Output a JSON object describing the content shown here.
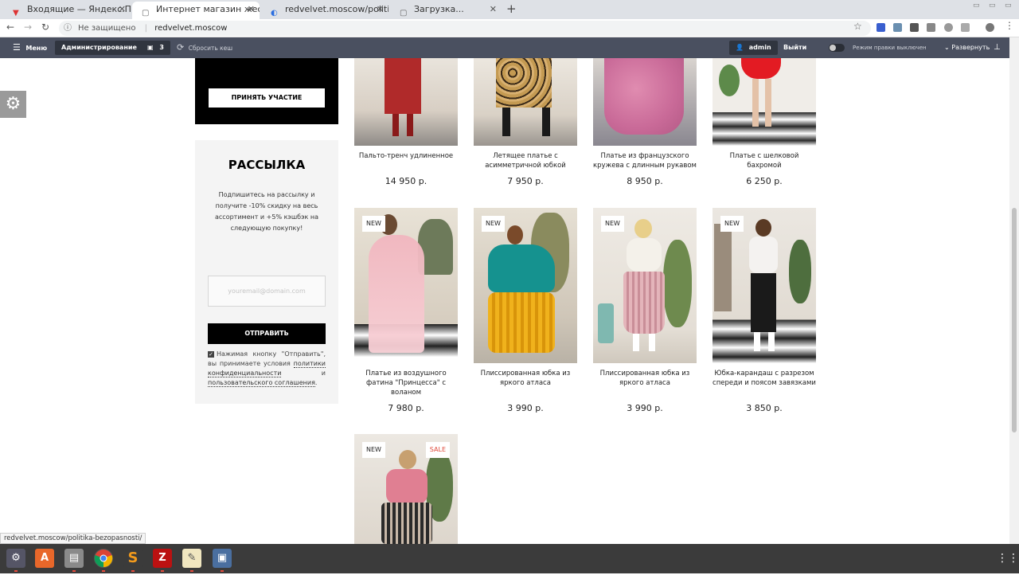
{
  "browser": {
    "tabs": [
      {
        "title": "Входящие — Яндекс.По",
        "icon": "yandex-mail-icon",
        "active": false
      },
      {
        "title": "Интернет магазин жеско",
        "icon": "page-icon",
        "active": true
      },
      {
        "title": "redvelvet.moscow/politi",
        "icon": "loading-icon",
        "active": false
      },
      {
        "title": "Загрузка...",
        "icon": "page-icon",
        "active": false
      }
    ],
    "not_secure": "Не защищено",
    "url": "redvelvet.moscow"
  },
  "adminbar": {
    "menu": "Меню",
    "administration": "Администрирование",
    "comments_count": "3",
    "reset_cache": "Сбросить кеш",
    "user": "admin",
    "logout": "Выйти",
    "edit_mode_label": "Режим правки",
    "edit_mode_state": "выключен",
    "expand": "Развернуть"
  },
  "promo": {
    "button": "ПРИНЯТЬ УЧАСТИЕ"
  },
  "newsletter": {
    "title": "РАССЫЛКА",
    "text": "Подпишитесь на рассылку и получите -10% скидку на весь ассортимент и +5% кэшбэк на следующую покупку!",
    "placeholder": "youremail@domain.com",
    "submit": "ОТПРАВИТЬ",
    "consent_prefix": "Нажимая кнопку \"Отправить\", вы принимаете условия",
    "consent_link1": "политики конфиденциальности",
    "consent_and": "и",
    "consent_link2": "пользовательского соглашения",
    "consent_suffix": "."
  },
  "products": [
    {
      "name": "Пальто-тренч удлиненное",
      "price": "14 950 р.",
      "badges": []
    },
    {
      "name": "Летящее платье с асимметричной юбкой",
      "price": "7 950 р.",
      "badges": []
    },
    {
      "name": "Платье из французского кружева с длинным рукавом",
      "price": "8 950 р.",
      "badges": []
    },
    {
      "name": "Платье с шелковой бахромой",
      "price": "6 250 р.",
      "badges": []
    },
    {
      "name": "Платье из воздушного фатина \"Принцесса\" с воланом",
      "price": "7 980 р.",
      "badges": [
        "NEW"
      ]
    },
    {
      "name": "Плиссированная юбка из яркого атласа",
      "price": "3 990 р.",
      "badges": [
        "NEW"
      ]
    },
    {
      "name": "Плиссированная юбка из яркого атласа",
      "price": "3 990 р.",
      "badges": [
        "NEW"
      ]
    },
    {
      "name": "Юбка-карандаш с разрезом спереди и поясом завязками",
      "price": "3 850 р.",
      "badges": [
        "NEW"
      ]
    },
    {
      "name": "",
      "price": "",
      "badges": [
        "NEW",
        "SALE"
      ]
    }
  ],
  "statusbar": {
    "url": "redvelvet.moscow/politika-bezopasnosti/"
  },
  "colors": {
    "sale": "#e04a3a",
    "admin_bar": "#4a5060",
    "newsletter_bg": "#f4f4f4"
  }
}
